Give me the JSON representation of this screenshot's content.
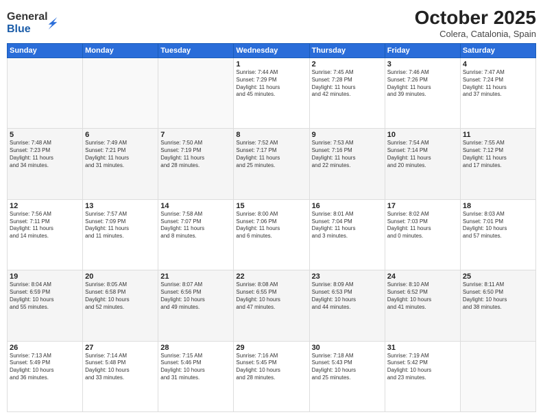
{
  "logo": {
    "general": "General",
    "blue": "Blue"
  },
  "title": "October 2025",
  "subtitle": "Colera, Catalonia, Spain",
  "days_of_week": [
    "Sunday",
    "Monday",
    "Tuesday",
    "Wednesday",
    "Thursday",
    "Friday",
    "Saturday"
  ],
  "weeks": [
    [
      {
        "day": "",
        "info": ""
      },
      {
        "day": "",
        "info": ""
      },
      {
        "day": "",
        "info": ""
      },
      {
        "day": "1",
        "info": "Sunrise: 7:44 AM\nSunset: 7:29 PM\nDaylight: 11 hours\nand 45 minutes."
      },
      {
        "day": "2",
        "info": "Sunrise: 7:45 AM\nSunset: 7:28 PM\nDaylight: 11 hours\nand 42 minutes."
      },
      {
        "day": "3",
        "info": "Sunrise: 7:46 AM\nSunset: 7:26 PM\nDaylight: 11 hours\nand 39 minutes."
      },
      {
        "day": "4",
        "info": "Sunrise: 7:47 AM\nSunset: 7:24 PM\nDaylight: 11 hours\nand 37 minutes."
      }
    ],
    [
      {
        "day": "5",
        "info": "Sunrise: 7:48 AM\nSunset: 7:23 PM\nDaylight: 11 hours\nand 34 minutes."
      },
      {
        "day": "6",
        "info": "Sunrise: 7:49 AM\nSunset: 7:21 PM\nDaylight: 11 hours\nand 31 minutes."
      },
      {
        "day": "7",
        "info": "Sunrise: 7:50 AM\nSunset: 7:19 PM\nDaylight: 11 hours\nand 28 minutes."
      },
      {
        "day": "8",
        "info": "Sunrise: 7:52 AM\nSunset: 7:17 PM\nDaylight: 11 hours\nand 25 minutes."
      },
      {
        "day": "9",
        "info": "Sunrise: 7:53 AM\nSunset: 7:16 PM\nDaylight: 11 hours\nand 22 minutes."
      },
      {
        "day": "10",
        "info": "Sunrise: 7:54 AM\nSunset: 7:14 PM\nDaylight: 11 hours\nand 20 minutes."
      },
      {
        "day": "11",
        "info": "Sunrise: 7:55 AM\nSunset: 7:12 PM\nDaylight: 11 hours\nand 17 minutes."
      }
    ],
    [
      {
        "day": "12",
        "info": "Sunrise: 7:56 AM\nSunset: 7:11 PM\nDaylight: 11 hours\nand 14 minutes."
      },
      {
        "day": "13",
        "info": "Sunrise: 7:57 AM\nSunset: 7:09 PM\nDaylight: 11 hours\nand 11 minutes."
      },
      {
        "day": "14",
        "info": "Sunrise: 7:58 AM\nSunset: 7:07 PM\nDaylight: 11 hours\nand 8 minutes."
      },
      {
        "day": "15",
        "info": "Sunrise: 8:00 AM\nSunset: 7:06 PM\nDaylight: 11 hours\nand 6 minutes."
      },
      {
        "day": "16",
        "info": "Sunrise: 8:01 AM\nSunset: 7:04 PM\nDaylight: 11 hours\nand 3 minutes."
      },
      {
        "day": "17",
        "info": "Sunrise: 8:02 AM\nSunset: 7:03 PM\nDaylight: 11 hours\nand 0 minutes."
      },
      {
        "day": "18",
        "info": "Sunrise: 8:03 AM\nSunset: 7:01 PM\nDaylight: 10 hours\nand 57 minutes."
      }
    ],
    [
      {
        "day": "19",
        "info": "Sunrise: 8:04 AM\nSunset: 6:59 PM\nDaylight: 10 hours\nand 55 minutes."
      },
      {
        "day": "20",
        "info": "Sunrise: 8:05 AM\nSunset: 6:58 PM\nDaylight: 10 hours\nand 52 minutes."
      },
      {
        "day": "21",
        "info": "Sunrise: 8:07 AM\nSunset: 6:56 PM\nDaylight: 10 hours\nand 49 minutes."
      },
      {
        "day": "22",
        "info": "Sunrise: 8:08 AM\nSunset: 6:55 PM\nDaylight: 10 hours\nand 47 minutes."
      },
      {
        "day": "23",
        "info": "Sunrise: 8:09 AM\nSunset: 6:53 PM\nDaylight: 10 hours\nand 44 minutes."
      },
      {
        "day": "24",
        "info": "Sunrise: 8:10 AM\nSunset: 6:52 PM\nDaylight: 10 hours\nand 41 minutes."
      },
      {
        "day": "25",
        "info": "Sunrise: 8:11 AM\nSunset: 6:50 PM\nDaylight: 10 hours\nand 38 minutes."
      }
    ],
    [
      {
        "day": "26",
        "info": "Sunrise: 7:13 AM\nSunset: 5:49 PM\nDaylight: 10 hours\nand 36 minutes."
      },
      {
        "day": "27",
        "info": "Sunrise: 7:14 AM\nSunset: 5:48 PM\nDaylight: 10 hours\nand 33 minutes."
      },
      {
        "day": "28",
        "info": "Sunrise: 7:15 AM\nSunset: 5:46 PM\nDaylight: 10 hours\nand 31 minutes."
      },
      {
        "day": "29",
        "info": "Sunrise: 7:16 AM\nSunset: 5:45 PM\nDaylight: 10 hours\nand 28 minutes."
      },
      {
        "day": "30",
        "info": "Sunrise: 7:18 AM\nSunset: 5:43 PM\nDaylight: 10 hours\nand 25 minutes."
      },
      {
        "day": "31",
        "info": "Sunrise: 7:19 AM\nSunset: 5:42 PM\nDaylight: 10 hours\nand 23 minutes."
      },
      {
        "day": "",
        "info": ""
      }
    ]
  ]
}
